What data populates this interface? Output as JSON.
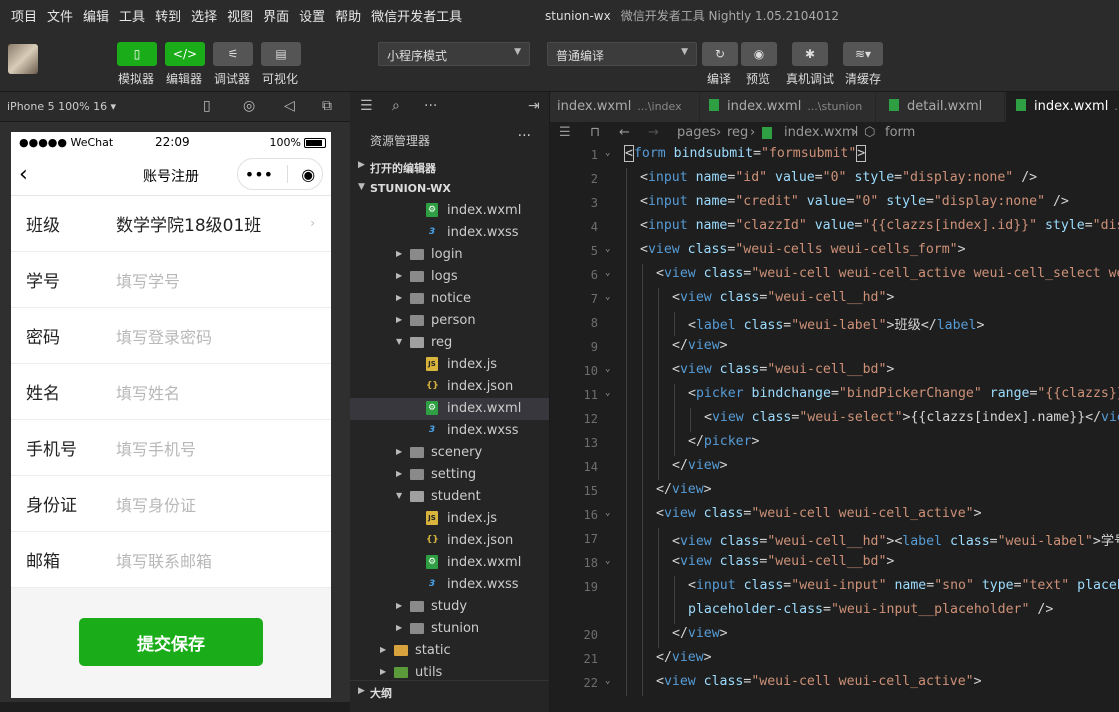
{
  "menubar": {
    "items": [
      "项目",
      "文件",
      "编辑",
      "工具",
      "转到",
      "选择",
      "视图",
      "界面",
      "设置",
      "帮助",
      "微信开发者工具"
    ],
    "project": "stunion-wx",
    "app_title": "微信开发者工具 Nightly 1.05.2104012"
  },
  "toolbar": {
    "simulator": "模拟器",
    "editor": "编辑器",
    "debugger": "调试器",
    "visual": "可视化",
    "mode_select": "小程序模式",
    "compile_select": "普通编译",
    "compile": "编译",
    "preview": "预览",
    "device_debug": "真机调试",
    "clear_cache": "清缓存"
  },
  "simulator": {
    "device": "iPhone 5 100% 16 ▾",
    "status": {
      "carrier": "●●●●● WeChat",
      "time": "22:09",
      "battery": "100%"
    },
    "nav_title": "账号注册",
    "form": [
      {
        "label": "班级",
        "value": "数学学院18级01班",
        "placeholder": ""
      },
      {
        "label": "学号",
        "value": "",
        "placeholder": "填写学号"
      },
      {
        "label": "密码",
        "value": "",
        "placeholder": "填写登录密码"
      },
      {
        "label": "姓名",
        "value": "",
        "placeholder": "填写姓名"
      },
      {
        "label": "手机号",
        "value": "",
        "placeholder": "填写手机号"
      },
      {
        "label": "身份证",
        "value": "",
        "placeholder": "填写身份证"
      },
      {
        "label": "邮箱",
        "value": "",
        "placeholder": "填写联系邮箱"
      }
    ],
    "submit": "提交保存"
  },
  "explorer": {
    "title": "资源管理器",
    "open_editors": "打开的编辑器",
    "root": "STUNION-WX",
    "outline": "大纲",
    "tree": [
      {
        "name": "index.wxml",
        "type": "wxml",
        "depth": 2
      },
      {
        "name": "index.wxss",
        "type": "wxss",
        "depth": 2
      },
      {
        "name": "login",
        "type": "folder",
        "depth": 1
      },
      {
        "name": "logs",
        "type": "folder",
        "depth": 1
      },
      {
        "name": "notice",
        "type": "folder",
        "depth": 1
      },
      {
        "name": "person",
        "type": "folder",
        "depth": 1
      },
      {
        "name": "reg",
        "type": "folder-open",
        "depth": 1
      },
      {
        "name": "index.js",
        "type": "js",
        "depth": 2
      },
      {
        "name": "index.json",
        "type": "json",
        "depth": 2
      },
      {
        "name": "index.wxml",
        "type": "wxml",
        "depth": 2,
        "selected": true
      },
      {
        "name": "index.wxss",
        "type": "wxss",
        "depth": 2
      },
      {
        "name": "scenery",
        "type": "folder",
        "depth": 1
      },
      {
        "name": "setting",
        "type": "folder",
        "depth": 1
      },
      {
        "name": "student",
        "type": "folder-open",
        "depth": 1
      },
      {
        "name": "index.js",
        "type": "js",
        "depth": 2
      },
      {
        "name": "index.json",
        "type": "json",
        "depth": 2
      },
      {
        "name": "index.wxml",
        "type": "wxml",
        "depth": 2
      },
      {
        "name": "index.wxss",
        "type": "wxss",
        "depth": 2
      },
      {
        "name": "study",
        "type": "folder",
        "depth": 1
      },
      {
        "name": "stunion",
        "type": "folder",
        "depth": 1
      },
      {
        "name": "static",
        "type": "static",
        "depth": 0
      },
      {
        "name": "utils",
        "type": "utils",
        "depth": 0
      }
    ]
  },
  "tabs": [
    {
      "name": "index.wxml",
      "path": "...\\index",
      "active": false
    },
    {
      "name": "index.wxml",
      "path": "...\\stunion",
      "active": false
    },
    {
      "name": "detail.wxml",
      "path": "",
      "active": false
    },
    {
      "name": "index.wxml",
      "path": "...\\",
      "active": true
    }
  ],
  "breadcrumb": {
    "pages": "pages",
    "reg": "reg",
    "file": "index.wxml",
    "node": "form"
  },
  "code": [
    {
      "n": "1",
      "fold": true,
      "indent": 0,
      "tokens": [
        [
          "p",
          "<"
        ],
        [
          "k",
          "form"
        ],
        [
          "a",
          " bindsubmit"
        ],
        [
          "p",
          "="
        ],
        [
          "s",
          "\"formsubmit\""
        ],
        [
          "p",
          ">"
        ]
      ]
    },
    {
      "n": "2",
      "indent": 1,
      "tokens": [
        [
          "p",
          "<"
        ],
        [
          "k",
          "input"
        ],
        [
          "a",
          " name"
        ],
        [
          "p",
          "="
        ],
        [
          "s",
          "\"id\""
        ],
        [
          "a",
          " value"
        ],
        [
          "p",
          "="
        ],
        [
          "s",
          "\"0\""
        ],
        [
          "a",
          " style"
        ],
        [
          "p",
          "="
        ],
        [
          "s",
          "\"display:none\""
        ],
        [
          "p",
          " />"
        ]
      ]
    },
    {
      "n": "3",
      "indent": 1,
      "tokens": [
        [
          "p",
          "<"
        ],
        [
          "k",
          "input"
        ],
        [
          "a",
          " name"
        ],
        [
          "p",
          "="
        ],
        [
          "s",
          "\"credit\""
        ],
        [
          "a",
          " value"
        ],
        [
          "p",
          "="
        ],
        [
          "s",
          "\"0\""
        ],
        [
          "a",
          " style"
        ],
        [
          "p",
          "="
        ],
        [
          "s",
          "\"display:none\""
        ],
        [
          "p",
          " />"
        ]
      ]
    },
    {
      "n": "4",
      "indent": 1,
      "tokens": [
        [
          "p",
          "<"
        ],
        [
          "k",
          "input"
        ],
        [
          "a",
          " name"
        ],
        [
          "p",
          "="
        ],
        [
          "s",
          "\"clazzId\""
        ],
        [
          "a",
          " value"
        ],
        [
          "p",
          "="
        ],
        [
          "s",
          "\"{{clazzs[index].id}}\""
        ],
        [
          "a",
          " style"
        ],
        [
          "p",
          "="
        ],
        [
          "s",
          "\"displ"
        ]
      ]
    },
    {
      "n": "5",
      "fold": true,
      "indent": 1,
      "tokens": [
        [
          "p",
          "<"
        ],
        [
          "k",
          "view"
        ],
        [
          "a",
          " class"
        ],
        [
          "p",
          "="
        ],
        [
          "s",
          "\"weui-cells weui-cells_form\""
        ],
        [
          "p",
          ">"
        ]
      ]
    },
    {
      "n": "6",
      "fold": true,
      "indent": 2,
      "tokens": [
        [
          "p",
          "<"
        ],
        [
          "k",
          "view"
        ],
        [
          "a",
          " class"
        ],
        [
          "p",
          "="
        ],
        [
          "s",
          "\"weui-cell weui-cell_active weui-cell_select weui"
        ]
      ]
    },
    {
      "n": "7",
      "fold": true,
      "indent": 3,
      "tokens": [
        [
          "p",
          "<"
        ],
        [
          "k",
          "view"
        ],
        [
          "a",
          " class"
        ],
        [
          "p",
          "="
        ],
        [
          "s",
          "\"weui-cell__hd\""
        ],
        [
          "p",
          ">"
        ]
      ]
    },
    {
      "n": "8",
      "indent": 4,
      "tokens": [
        [
          "p",
          "<"
        ],
        [
          "k",
          "label"
        ],
        [
          "a",
          " class"
        ],
        [
          "p",
          "="
        ],
        [
          "s",
          "\"weui-label\""
        ],
        [
          "p",
          ">班级</"
        ],
        [
          "k",
          "label"
        ],
        [
          "p",
          ">"
        ]
      ]
    },
    {
      "n": "9",
      "indent": 3,
      "tokens": [
        [
          "p",
          "</"
        ],
        [
          "k",
          "view"
        ],
        [
          "p",
          ">"
        ]
      ]
    },
    {
      "n": "10",
      "fold": true,
      "indent": 3,
      "tokens": [
        [
          "p",
          "<"
        ],
        [
          "k",
          "view"
        ],
        [
          "a",
          " class"
        ],
        [
          "p",
          "="
        ],
        [
          "s",
          "\"weui-cell__bd\""
        ],
        [
          "p",
          ">"
        ]
      ]
    },
    {
      "n": "11",
      "fold": true,
      "indent": 4,
      "tokens": [
        [
          "p",
          "<"
        ],
        [
          "k",
          "picker"
        ],
        [
          "a",
          " bindchange"
        ],
        [
          "p",
          "="
        ],
        [
          "s",
          "\"bindPickerChange\""
        ],
        [
          "a",
          " range"
        ],
        [
          "p",
          "="
        ],
        [
          "s",
          "\"{{clazzs}}\""
        ]
      ]
    },
    {
      "n": "12",
      "indent": 5,
      "tokens": [
        [
          "p",
          "<"
        ],
        [
          "k",
          "view"
        ],
        [
          "a",
          " class"
        ],
        [
          "p",
          "="
        ],
        [
          "s",
          "\"weui-select\""
        ],
        [
          "p",
          ">{{clazzs[index].name}}</"
        ],
        [
          "k",
          "view"
        ],
        [
          "p",
          ">"
        ]
      ]
    },
    {
      "n": "13",
      "indent": 4,
      "tokens": [
        [
          "p",
          "</"
        ],
        [
          "k",
          "picker"
        ],
        [
          "p",
          ">"
        ]
      ]
    },
    {
      "n": "14",
      "indent": 3,
      "tokens": [
        [
          "p",
          "</"
        ],
        [
          "k",
          "view"
        ],
        [
          "p",
          ">"
        ]
      ]
    },
    {
      "n": "15",
      "indent": 2,
      "tokens": [
        [
          "p",
          "</"
        ],
        [
          "k",
          "view"
        ],
        [
          "p",
          ">"
        ]
      ]
    },
    {
      "n": "16",
      "fold": true,
      "indent": 2,
      "tokens": [
        [
          "p",
          "<"
        ],
        [
          "k",
          "view"
        ],
        [
          "a",
          " class"
        ],
        [
          "p",
          "="
        ],
        [
          "s",
          "\"weui-cell weui-cell_active\""
        ],
        [
          "p",
          ">"
        ]
      ]
    },
    {
      "n": "17",
      "indent": 3,
      "tokens": [
        [
          "p",
          "<"
        ],
        [
          "k",
          "view"
        ],
        [
          "a",
          " class"
        ],
        [
          "p",
          "="
        ],
        [
          "s",
          "\"weui-cell__hd\""
        ],
        [
          "p",
          "><"
        ],
        [
          "k",
          "label"
        ],
        [
          "a",
          " class"
        ],
        [
          "p",
          "="
        ],
        [
          "s",
          "\"weui-label\""
        ],
        [
          "p",
          ">学号</"
        ]
      ]
    },
    {
      "n": "18",
      "fold": true,
      "indent": 3,
      "tokens": [
        [
          "p",
          "<"
        ],
        [
          "k",
          "view"
        ],
        [
          "a",
          " class"
        ],
        [
          "p",
          "="
        ],
        [
          "s",
          "\"weui-cell__bd\""
        ],
        [
          "p",
          ">"
        ]
      ]
    },
    {
      "n": "19",
      "indent": 4,
      "tokens": [
        [
          "p",
          "<"
        ],
        [
          "k",
          "input"
        ],
        [
          "a",
          " class"
        ],
        [
          "p",
          "="
        ],
        [
          "s",
          "\"weui-input\""
        ],
        [
          "a",
          " name"
        ],
        [
          "p",
          "="
        ],
        [
          "s",
          "\"sno\""
        ],
        [
          "a",
          " type"
        ],
        [
          "p",
          "="
        ],
        [
          "s",
          "\"text\""
        ],
        [
          "a",
          " placehol"
        ]
      ]
    },
    {
      "n": "",
      "indent": 4,
      "tokens": [
        [
          "a",
          "placeholder-class"
        ],
        [
          "p",
          "="
        ],
        [
          "s",
          "\"weui-input__placeholder\""
        ],
        [
          "p",
          " />"
        ]
      ]
    },
    {
      "n": "20",
      "indent": 3,
      "tokens": [
        [
          "p",
          "</"
        ],
        [
          "k",
          "view"
        ],
        [
          "p",
          ">"
        ]
      ]
    },
    {
      "n": "21",
      "indent": 2,
      "tokens": [
        [
          "p",
          "</"
        ],
        [
          "k",
          "view"
        ],
        [
          "p",
          ">"
        ]
      ]
    },
    {
      "n": "22",
      "fold": true,
      "indent": 2,
      "tokens": [
        [
          "p",
          "<"
        ],
        [
          "k",
          "view"
        ],
        [
          "a",
          " class"
        ],
        [
          "p",
          "="
        ],
        [
          "s",
          "\"weui-cell weui-cell_active\""
        ],
        [
          "p",
          ">"
        ]
      ]
    }
  ],
  "colors": {
    "accent": "#1aad19",
    "tag": "#569cd6",
    "attr": "#9cdcfe",
    "string": "#ce9178"
  }
}
